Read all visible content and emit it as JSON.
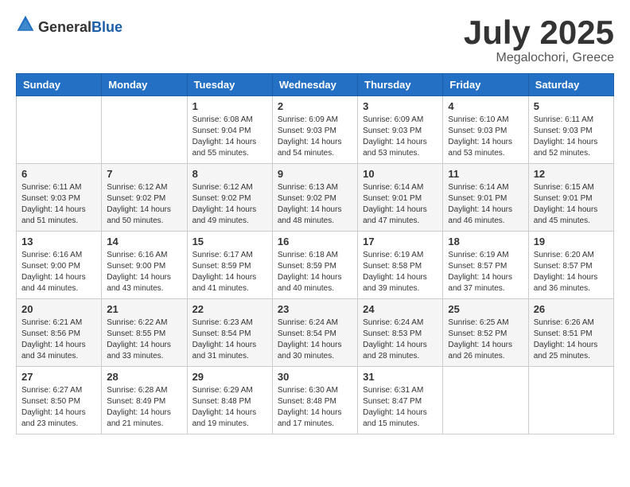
{
  "logo": {
    "general": "General",
    "blue": "Blue"
  },
  "title": "July 2025",
  "location": "Megalochori, Greece",
  "days_of_week": [
    "Sunday",
    "Monday",
    "Tuesday",
    "Wednesday",
    "Thursday",
    "Friday",
    "Saturday"
  ],
  "weeks": [
    [
      {
        "day": "",
        "info": ""
      },
      {
        "day": "",
        "info": ""
      },
      {
        "day": "1",
        "info": "Sunrise: 6:08 AM\nSunset: 9:04 PM\nDaylight: 14 hours and 55 minutes."
      },
      {
        "day": "2",
        "info": "Sunrise: 6:09 AM\nSunset: 9:03 PM\nDaylight: 14 hours and 54 minutes."
      },
      {
        "day": "3",
        "info": "Sunrise: 6:09 AM\nSunset: 9:03 PM\nDaylight: 14 hours and 53 minutes."
      },
      {
        "day": "4",
        "info": "Sunrise: 6:10 AM\nSunset: 9:03 PM\nDaylight: 14 hours and 53 minutes."
      },
      {
        "day": "5",
        "info": "Sunrise: 6:11 AM\nSunset: 9:03 PM\nDaylight: 14 hours and 52 minutes."
      }
    ],
    [
      {
        "day": "6",
        "info": "Sunrise: 6:11 AM\nSunset: 9:03 PM\nDaylight: 14 hours and 51 minutes."
      },
      {
        "day": "7",
        "info": "Sunrise: 6:12 AM\nSunset: 9:02 PM\nDaylight: 14 hours and 50 minutes."
      },
      {
        "day": "8",
        "info": "Sunrise: 6:12 AM\nSunset: 9:02 PM\nDaylight: 14 hours and 49 minutes."
      },
      {
        "day": "9",
        "info": "Sunrise: 6:13 AM\nSunset: 9:02 PM\nDaylight: 14 hours and 48 minutes."
      },
      {
        "day": "10",
        "info": "Sunrise: 6:14 AM\nSunset: 9:01 PM\nDaylight: 14 hours and 47 minutes."
      },
      {
        "day": "11",
        "info": "Sunrise: 6:14 AM\nSunset: 9:01 PM\nDaylight: 14 hours and 46 minutes."
      },
      {
        "day": "12",
        "info": "Sunrise: 6:15 AM\nSunset: 9:01 PM\nDaylight: 14 hours and 45 minutes."
      }
    ],
    [
      {
        "day": "13",
        "info": "Sunrise: 6:16 AM\nSunset: 9:00 PM\nDaylight: 14 hours and 44 minutes."
      },
      {
        "day": "14",
        "info": "Sunrise: 6:16 AM\nSunset: 9:00 PM\nDaylight: 14 hours and 43 minutes."
      },
      {
        "day": "15",
        "info": "Sunrise: 6:17 AM\nSunset: 8:59 PM\nDaylight: 14 hours and 41 minutes."
      },
      {
        "day": "16",
        "info": "Sunrise: 6:18 AM\nSunset: 8:59 PM\nDaylight: 14 hours and 40 minutes."
      },
      {
        "day": "17",
        "info": "Sunrise: 6:19 AM\nSunset: 8:58 PM\nDaylight: 14 hours and 39 minutes."
      },
      {
        "day": "18",
        "info": "Sunrise: 6:19 AM\nSunset: 8:57 PM\nDaylight: 14 hours and 37 minutes."
      },
      {
        "day": "19",
        "info": "Sunrise: 6:20 AM\nSunset: 8:57 PM\nDaylight: 14 hours and 36 minutes."
      }
    ],
    [
      {
        "day": "20",
        "info": "Sunrise: 6:21 AM\nSunset: 8:56 PM\nDaylight: 14 hours and 34 minutes."
      },
      {
        "day": "21",
        "info": "Sunrise: 6:22 AM\nSunset: 8:55 PM\nDaylight: 14 hours and 33 minutes."
      },
      {
        "day": "22",
        "info": "Sunrise: 6:23 AM\nSunset: 8:54 PM\nDaylight: 14 hours and 31 minutes."
      },
      {
        "day": "23",
        "info": "Sunrise: 6:24 AM\nSunset: 8:54 PM\nDaylight: 14 hours and 30 minutes."
      },
      {
        "day": "24",
        "info": "Sunrise: 6:24 AM\nSunset: 8:53 PM\nDaylight: 14 hours and 28 minutes."
      },
      {
        "day": "25",
        "info": "Sunrise: 6:25 AM\nSunset: 8:52 PM\nDaylight: 14 hours and 26 minutes."
      },
      {
        "day": "26",
        "info": "Sunrise: 6:26 AM\nSunset: 8:51 PM\nDaylight: 14 hours and 25 minutes."
      }
    ],
    [
      {
        "day": "27",
        "info": "Sunrise: 6:27 AM\nSunset: 8:50 PM\nDaylight: 14 hours and 23 minutes."
      },
      {
        "day": "28",
        "info": "Sunrise: 6:28 AM\nSunset: 8:49 PM\nDaylight: 14 hours and 21 minutes."
      },
      {
        "day": "29",
        "info": "Sunrise: 6:29 AM\nSunset: 8:48 PM\nDaylight: 14 hours and 19 minutes."
      },
      {
        "day": "30",
        "info": "Sunrise: 6:30 AM\nSunset: 8:48 PM\nDaylight: 14 hours and 17 minutes."
      },
      {
        "day": "31",
        "info": "Sunrise: 6:31 AM\nSunset: 8:47 PM\nDaylight: 14 hours and 15 minutes."
      },
      {
        "day": "",
        "info": ""
      },
      {
        "day": "",
        "info": ""
      }
    ]
  ]
}
